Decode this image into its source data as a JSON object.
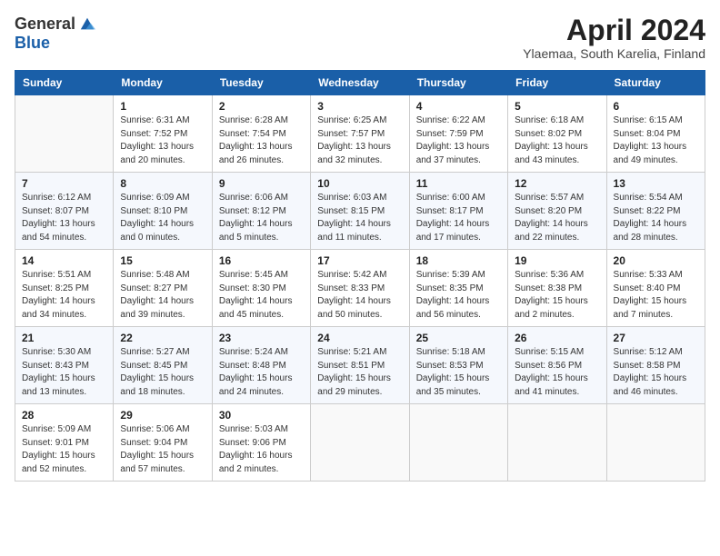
{
  "header": {
    "logo_general": "General",
    "logo_blue": "Blue",
    "title": "April 2024",
    "subtitle": "Ylaemaa, South Karelia, Finland"
  },
  "days_of_week": [
    "Sunday",
    "Monday",
    "Tuesday",
    "Wednesday",
    "Thursday",
    "Friday",
    "Saturday"
  ],
  "weeks": [
    [
      {
        "day": "",
        "info": ""
      },
      {
        "day": "1",
        "info": "Sunrise: 6:31 AM\nSunset: 7:52 PM\nDaylight: 13 hours\nand 20 minutes."
      },
      {
        "day": "2",
        "info": "Sunrise: 6:28 AM\nSunset: 7:54 PM\nDaylight: 13 hours\nand 26 minutes."
      },
      {
        "day": "3",
        "info": "Sunrise: 6:25 AM\nSunset: 7:57 PM\nDaylight: 13 hours\nand 32 minutes."
      },
      {
        "day": "4",
        "info": "Sunrise: 6:22 AM\nSunset: 7:59 PM\nDaylight: 13 hours\nand 37 minutes."
      },
      {
        "day": "5",
        "info": "Sunrise: 6:18 AM\nSunset: 8:02 PM\nDaylight: 13 hours\nand 43 minutes."
      },
      {
        "day": "6",
        "info": "Sunrise: 6:15 AM\nSunset: 8:04 PM\nDaylight: 13 hours\nand 49 minutes."
      }
    ],
    [
      {
        "day": "7",
        "info": "Sunrise: 6:12 AM\nSunset: 8:07 PM\nDaylight: 13 hours\nand 54 minutes."
      },
      {
        "day": "8",
        "info": "Sunrise: 6:09 AM\nSunset: 8:10 PM\nDaylight: 14 hours\nand 0 minutes."
      },
      {
        "day": "9",
        "info": "Sunrise: 6:06 AM\nSunset: 8:12 PM\nDaylight: 14 hours\nand 5 minutes."
      },
      {
        "day": "10",
        "info": "Sunrise: 6:03 AM\nSunset: 8:15 PM\nDaylight: 14 hours\nand 11 minutes."
      },
      {
        "day": "11",
        "info": "Sunrise: 6:00 AM\nSunset: 8:17 PM\nDaylight: 14 hours\nand 17 minutes."
      },
      {
        "day": "12",
        "info": "Sunrise: 5:57 AM\nSunset: 8:20 PM\nDaylight: 14 hours\nand 22 minutes."
      },
      {
        "day": "13",
        "info": "Sunrise: 5:54 AM\nSunset: 8:22 PM\nDaylight: 14 hours\nand 28 minutes."
      }
    ],
    [
      {
        "day": "14",
        "info": "Sunrise: 5:51 AM\nSunset: 8:25 PM\nDaylight: 14 hours\nand 34 minutes."
      },
      {
        "day": "15",
        "info": "Sunrise: 5:48 AM\nSunset: 8:27 PM\nDaylight: 14 hours\nand 39 minutes."
      },
      {
        "day": "16",
        "info": "Sunrise: 5:45 AM\nSunset: 8:30 PM\nDaylight: 14 hours\nand 45 minutes."
      },
      {
        "day": "17",
        "info": "Sunrise: 5:42 AM\nSunset: 8:33 PM\nDaylight: 14 hours\nand 50 minutes."
      },
      {
        "day": "18",
        "info": "Sunrise: 5:39 AM\nSunset: 8:35 PM\nDaylight: 14 hours\nand 56 minutes."
      },
      {
        "day": "19",
        "info": "Sunrise: 5:36 AM\nSunset: 8:38 PM\nDaylight: 15 hours\nand 2 minutes."
      },
      {
        "day": "20",
        "info": "Sunrise: 5:33 AM\nSunset: 8:40 PM\nDaylight: 15 hours\nand 7 minutes."
      }
    ],
    [
      {
        "day": "21",
        "info": "Sunrise: 5:30 AM\nSunset: 8:43 PM\nDaylight: 15 hours\nand 13 minutes."
      },
      {
        "day": "22",
        "info": "Sunrise: 5:27 AM\nSunset: 8:45 PM\nDaylight: 15 hours\nand 18 minutes."
      },
      {
        "day": "23",
        "info": "Sunrise: 5:24 AM\nSunset: 8:48 PM\nDaylight: 15 hours\nand 24 minutes."
      },
      {
        "day": "24",
        "info": "Sunrise: 5:21 AM\nSunset: 8:51 PM\nDaylight: 15 hours\nand 29 minutes."
      },
      {
        "day": "25",
        "info": "Sunrise: 5:18 AM\nSunset: 8:53 PM\nDaylight: 15 hours\nand 35 minutes."
      },
      {
        "day": "26",
        "info": "Sunrise: 5:15 AM\nSunset: 8:56 PM\nDaylight: 15 hours\nand 41 minutes."
      },
      {
        "day": "27",
        "info": "Sunrise: 5:12 AM\nSunset: 8:58 PM\nDaylight: 15 hours\nand 46 minutes."
      }
    ],
    [
      {
        "day": "28",
        "info": "Sunrise: 5:09 AM\nSunset: 9:01 PM\nDaylight: 15 hours\nand 52 minutes."
      },
      {
        "day": "29",
        "info": "Sunrise: 5:06 AM\nSunset: 9:04 PM\nDaylight: 15 hours\nand 57 minutes."
      },
      {
        "day": "30",
        "info": "Sunrise: 5:03 AM\nSunset: 9:06 PM\nDaylight: 16 hours\nand 2 minutes."
      },
      {
        "day": "",
        "info": ""
      },
      {
        "day": "",
        "info": ""
      },
      {
        "day": "",
        "info": ""
      },
      {
        "day": "",
        "info": ""
      }
    ]
  ]
}
